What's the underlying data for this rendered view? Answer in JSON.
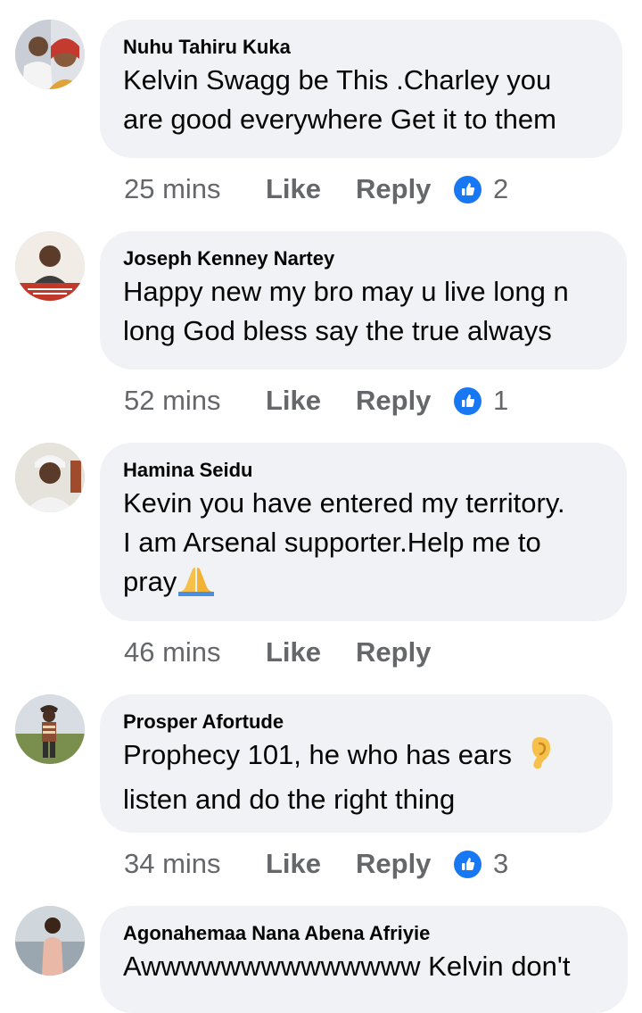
{
  "comments": [
    {
      "author": "Nuhu Tahiru Kuka",
      "lines": [
        "Kelvin Swagg be This .Charley you",
        "are good everywhere Get it to them"
      ],
      "time": "25 mins",
      "like_label": "Like",
      "reply_label": "Reply",
      "reaction_count": "2"
    },
    {
      "author": "Joseph Kenney Nartey",
      "lines": [
        "Happy new my bro may u live long n",
        "long God bless say the true always"
      ],
      "time": "52 mins",
      "like_label": "Like",
      "reply_label": "Reply",
      "reaction_count": "1"
    },
    {
      "author": "Hamina Seidu",
      "lines": [
        "Kevin you have entered my territory.",
        "I am Arsenal supporter.Help me to",
        "pray"
      ],
      "emoji": "praying-hands-emoji",
      "time": "46 mins",
      "like_label": "Like",
      "reply_label": "Reply"
    },
    {
      "author": "Prosper Afortude",
      "lines": [
        "Prophecy 101, he who has ears",
        "listen and do the right thing"
      ],
      "emoji": "ear-emoji",
      "time": "34 mins",
      "like_label": "Like",
      "reply_label": "Reply",
      "reaction_count": "3"
    },
    {
      "author": "Agonahemaa Nana Abena Afriyie",
      "lines": [
        "Awwwwwwwwwwwwww Kelvin don't"
      ]
    }
  ],
  "colors": {
    "bubble": "#f0f2f5",
    "text": "#050505",
    "meta": "#65676b",
    "like_badge": "#1877f2"
  },
  "icons": {
    "reaction": "like-thumb-icon"
  }
}
